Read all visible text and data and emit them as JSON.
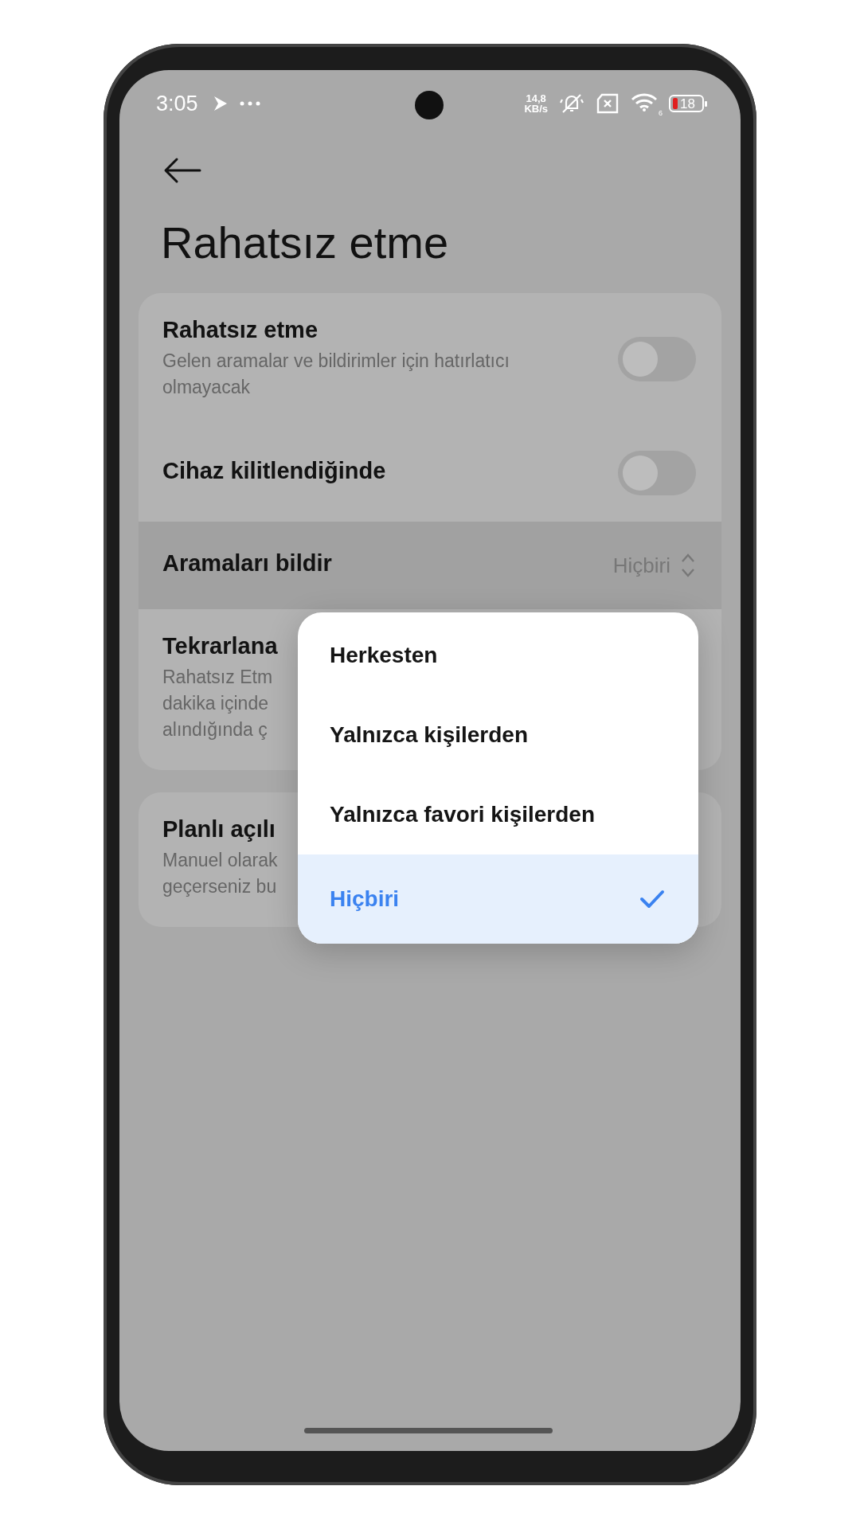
{
  "status_bar": {
    "time": "3:05",
    "speed_value": "14,8",
    "speed_unit": "KB/s",
    "wifi_label": "6",
    "battery": "18"
  },
  "header": {
    "title": "Rahatsız etme"
  },
  "cards": [
    {
      "rows": [
        {
          "kind": "toggle",
          "title": "Rahatsız etme",
          "subtitle": [
            "Gelen aramalar ve bildirimler için hatırlatıcı",
            "olmayacak"
          ],
          "on": false,
          "active": false
        },
        {
          "kind": "toggle",
          "title": "Cihaz kilitlendiğinde",
          "on": false,
          "active": false
        },
        {
          "kind": "select",
          "title": "Aramaları bildir",
          "value": "Hiçbiri",
          "active": true
        },
        {
          "kind": "text",
          "title": "Tekrarlana",
          "subtitle": [
            "Rahatsız Etm",
            "dakika içinde",
            "alındığında ç"
          ],
          "active": false
        }
      ]
    },
    {
      "rows": [
        {
          "kind": "text",
          "title": "Planlı açılı",
          "subtitle": [
            "Manuel olarak",
            "geçerseniz bu"
          ],
          "active": false
        }
      ]
    }
  ],
  "popup": {
    "options": [
      {
        "label": "Herkesten",
        "selected": false
      },
      {
        "label": "Yalnızca kişilerden",
        "selected": false
      },
      {
        "label": "Yalnızca favori kişilerden",
        "selected": false
      },
      {
        "label": "Hiçbiri",
        "selected": true
      }
    ]
  }
}
